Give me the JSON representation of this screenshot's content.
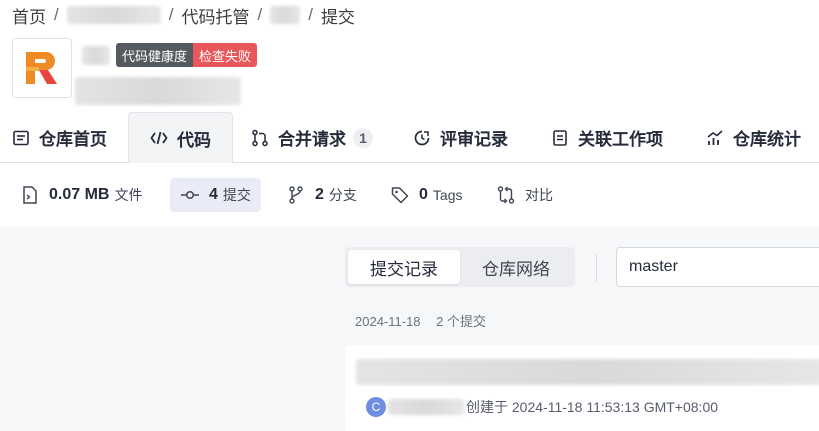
{
  "breadcrumb": {
    "home": "首页",
    "separator": "/",
    "code_hosting": "代码托管",
    "current": "提交"
  },
  "repo": {
    "badge_health": "代码健康度",
    "badge_status": "检查失败",
    "logo_letter": "R",
    "colors": {
      "logo_orange": "#f08a24",
      "logo_red": "#e8463a",
      "badge_dark": "#555a60",
      "badge_red": "#e8585a"
    }
  },
  "tabs": [
    {
      "label": "仓库首页",
      "icon": "repo-home-icon"
    },
    {
      "label": "代码",
      "icon": "code-icon",
      "active": true
    },
    {
      "label": "合并请求",
      "icon": "merge-request-icon",
      "count": "1"
    },
    {
      "label": "评审记录",
      "icon": "review-icon"
    },
    {
      "label": "关联工作项",
      "icon": "work-item-icon"
    },
    {
      "label": "仓库统计",
      "icon": "stats-icon"
    }
  ],
  "stats": {
    "size": {
      "value": "0.07 MB",
      "label": "文件",
      "icon": "file-icon"
    },
    "commits": {
      "value": "4",
      "label": "提交",
      "icon": "commit-icon",
      "active": true
    },
    "branches": {
      "value": "2",
      "label": "分支",
      "icon": "branch-icon"
    },
    "tags": {
      "value": "0",
      "label": "Tags",
      "icon": "tag-icon"
    },
    "compare": {
      "label": "对比",
      "icon": "compare-icon"
    }
  },
  "commits_view": {
    "toggle": {
      "history": "提交记录",
      "network": "仓库网络"
    },
    "branch": "master",
    "group": {
      "date": "2024-11-18",
      "count_text": "2 个提交"
    },
    "commit": {
      "avatar_letter": "C",
      "created_text": "创建于 2024-11-18 11:53:13 GMT+08:00"
    }
  }
}
